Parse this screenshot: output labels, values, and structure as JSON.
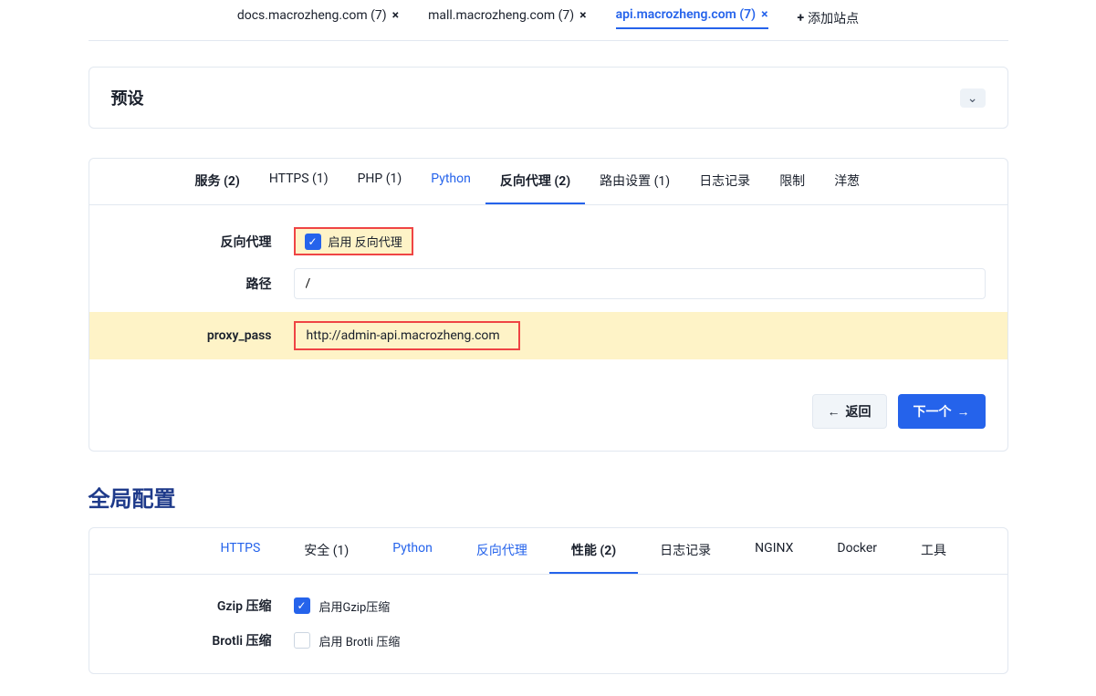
{
  "siteTabs": [
    {
      "label": "docs.macrozheng.com (7)",
      "active": false
    },
    {
      "label": "mall.macrozheng.com (7)",
      "active": false
    },
    {
      "label": "api.macrozheng.com (7)",
      "active": true
    }
  ],
  "addSite": "添加站点",
  "preset": {
    "title": "预设",
    "tabs": [
      "服务 (2)",
      "HTTPS (1)",
      "PHP (1)",
      "Python",
      "反向代理 (2)",
      "路由设置 (1)",
      "日志记录",
      "限制",
      "洋葱"
    ],
    "activeIndex": 4,
    "form": {
      "reverseProxyLabel": "反向代理",
      "enableReverseProxy": "启用 反向代理",
      "pathLabel": "路径",
      "pathValue": "/",
      "proxyPassLabel": "proxy_pass",
      "proxyPassValue": "http://admin-api.macrozheng.com"
    },
    "backBtn": "返回",
    "nextBtn": "下一个"
  },
  "global": {
    "title": "全局配置",
    "tabs": [
      "HTTPS",
      "安全 (1)",
      "Python",
      "反向代理",
      "性能 (2)",
      "日志记录",
      "NGINX",
      "Docker",
      "工具"
    ],
    "activeIndex": 4,
    "blueIndices": [
      0,
      2,
      3
    ],
    "form": {
      "gzipLabel": "Gzip 压缩",
      "gzipEnable": "启用Gzip压缩",
      "brotliLabel": "Brotli 压缩",
      "brotliEnable": "启用 Brotli 压缩"
    }
  }
}
